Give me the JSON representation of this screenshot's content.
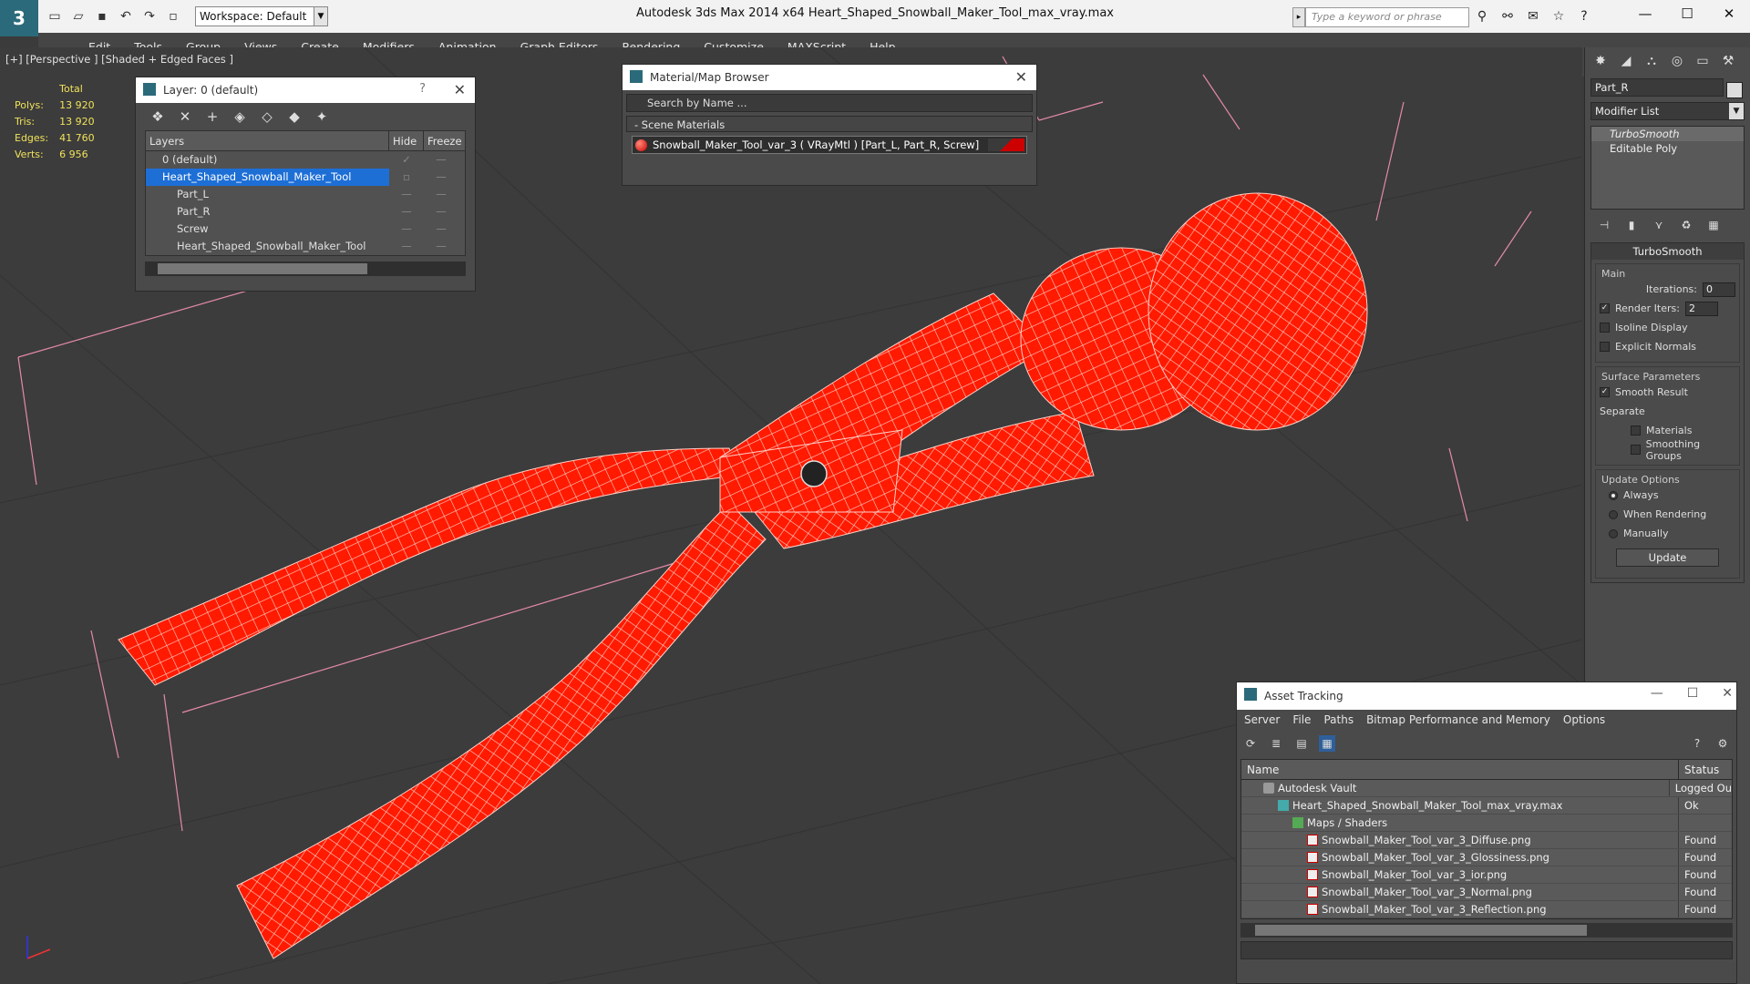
{
  "app": {
    "title": "Autodesk 3ds Max  2014 x64      Heart_Shaped_Snowball_Maker_Tool_max_vray.max",
    "workspace": "Workspace: Default",
    "search_placeholder": "Type a keyword or phrase",
    "menu": [
      "Edit",
      "Tools",
      "Group",
      "Views",
      "Create",
      "Modifiers",
      "Animation",
      "Graph Editors",
      "Rendering",
      "Customize",
      "MAXScript",
      "Help"
    ]
  },
  "viewport": {
    "label": "[+] [Perspective ] [Shaded + Edged Faces ]",
    "stats": {
      "header": "Total",
      "rows": [
        {
          "label": "Polys:",
          "value": "13 920"
        },
        {
          "label": "Tris:",
          "value": "13 920"
        },
        {
          "label": "Edges:",
          "value": "41 760"
        },
        {
          "label": "Verts:",
          "value": "6 956"
        }
      ]
    },
    "model_color": "#ff1a00"
  },
  "layer_panel": {
    "title": "Layer: 0 (default)",
    "help": "?",
    "columns": [
      "Layers",
      "Hide",
      "Freeze"
    ],
    "rows": [
      {
        "name": "0 (default)"
      },
      {
        "name": "Heart_Shaped_Snowball_Maker_Tool"
      },
      {
        "name": "Part_L"
      },
      {
        "name": "Part_R"
      },
      {
        "name": "Screw"
      },
      {
        "name": "Heart_Shaped_Snowball_Maker_Tool"
      }
    ]
  },
  "material_browser": {
    "title": "Material/Map Browser",
    "search_placeholder": "Search by Name ...",
    "section": "- Scene Materials",
    "item": "Snowball_Maker_Tool_var_3  ( VRayMtl ) [Part_L, Part_R, Screw]"
  },
  "command_panel": {
    "object_name": "Part_R",
    "modifier_list": "Modifier List",
    "stack": [
      "TurboSmooth",
      "Editable Poly"
    ],
    "rollout_title": "TurboSmooth",
    "main_group": "Main",
    "iterations_label": "Iterations:",
    "iterations_value": "0",
    "render_iters_label": "Render Iters:",
    "render_iters_value": "2",
    "isoline_display": "Isoline Display",
    "explicit_normals": "Explicit Normals",
    "surface_group": "Surface Parameters",
    "smooth_result": "Smooth Result",
    "separate": "Separate",
    "materials": "Materials",
    "smoothing_groups": "Smoothing Groups",
    "update_group": "Update Options",
    "always": "Always",
    "when_rendering": "When Rendering",
    "manually": "Manually",
    "update_button": "Update"
  },
  "asset_tracking": {
    "title": "Asset Tracking",
    "menu": [
      "Server",
      "File",
      "Paths",
      "Bitmap Performance and Memory",
      "Options"
    ],
    "columns": [
      "Name",
      "Status"
    ],
    "rows": [
      {
        "name": "Autodesk Vault",
        "status": "Logged Ou"
      },
      {
        "name": "Heart_Shaped_Snowball_Maker_Tool_max_vray.max",
        "status": "Ok"
      },
      {
        "name": "Maps / Shaders",
        "status": ""
      },
      {
        "name": "Snowball_Maker_Tool_var_3_Diffuse.png",
        "status": "Found"
      },
      {
        "name": "Snowball_Maker_Tool_var_3_Glossiness.png",
        "status": "Found"
      },
      {
        "name": "Snowball_Maker_Tool_var_3_ior.png",
        "status": "Found"
      },
      {
        "name": "Snowball_Maker_Tool_var_3_Normal.png",
        "status": "Found"
      },
      {
        "name": "Snowball_Maker_Tool_var_3_Reflection.png",
        "status": "Found"
      }
    ]
  }
}
